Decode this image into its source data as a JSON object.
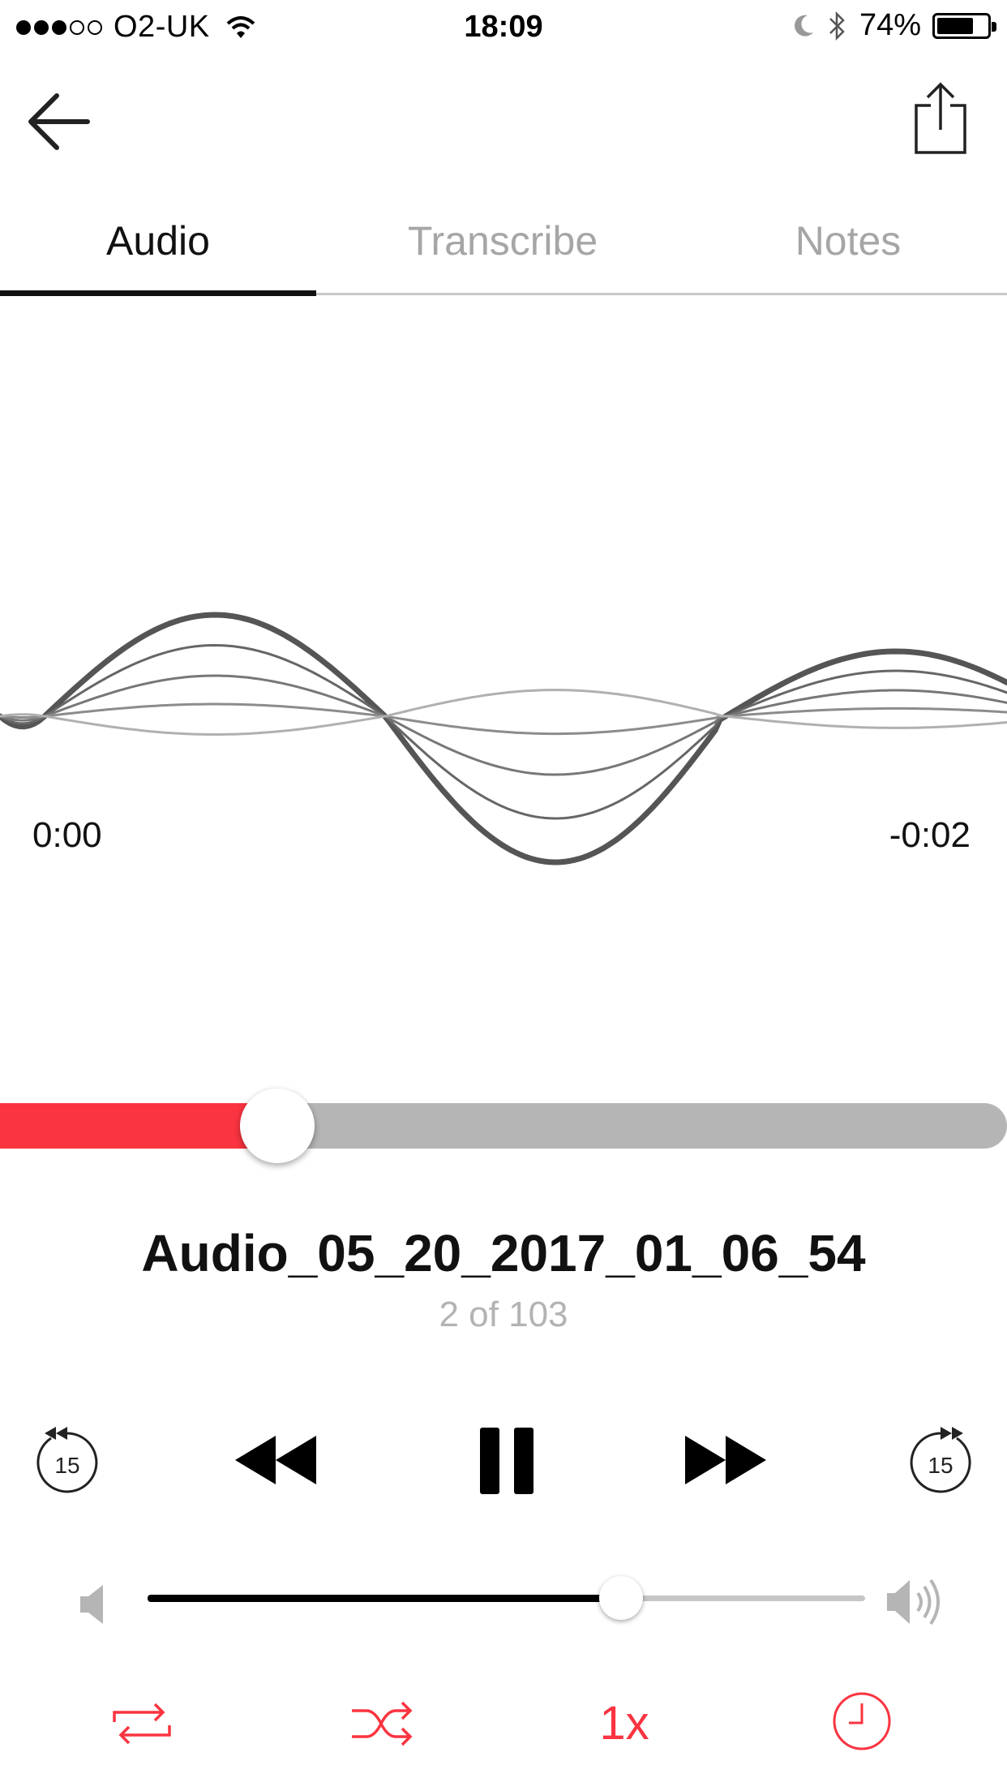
{
  "status_bar": {
    "carrier": "O2-UK",
    "time": "18:09",
    "battery": "74%",
    "battery_level": 0.74,
    "signal_bars_filled": 3,
    "signal_bars_total": 5
  },
  "tabs": [
    {
      "label": "Audio",
      "active": true
    },
    {
      "label": "Transcribe",
      "active": false
    },
    {
      "label": "Notes",
      "active": false
    }
  ],
  "player": {
    "elapsed": "0:00",
    "remaining": "-0:02",
    "progress": 0.275,
    "title": "Audio_05_20_2017_01_06_54",
    "position_text": "2 of 103",
    "skip_back_seconds": "15",
    "skip_forward_seconds": "15",
    "volume": 0.66,
    "speed": "1x"
  },
  "colors": {
    "accent": "#fa3440",
    "waveform": "#555555",
    "inactive_tab": "#a6a6a6"
  },
  "icons": {
    "back": "arrow-left-icon",
    "share": "share-icon",
    "skip_back": "rewind-15-icon",
    "rewind": "rewind-icon",
    "pause": "pause-icon",
    "fast_forward": "fast-forward-icon",
    "skip_forward": "forward-15-icon",
    "volume_min": "speaker-low-icon",
    "volume_max": "speaker-high-icon",
    "repeat": "repeat-icon",
    "shuffle": "shuffle-icon",
    "timer": "sleep-timer-icon"
  }
}
